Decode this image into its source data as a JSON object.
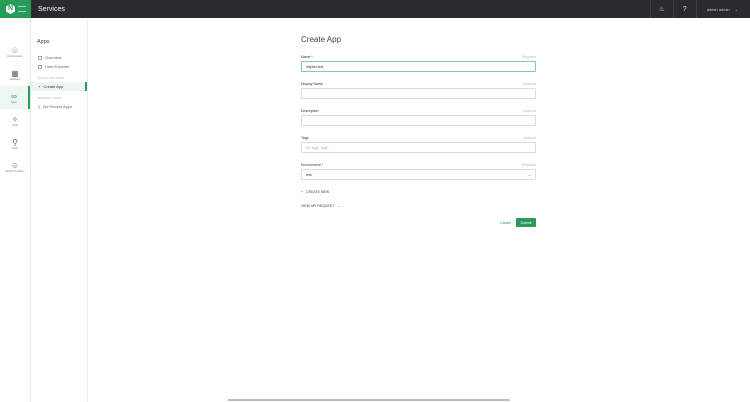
{
  "header": {
    "title": "Services",
    "user": "admin admin"
  },
  "rail": [
    {
      "label": "Environments",
      "icon": "bell-flask-icon"
    },
    {
      "label": "Gateways",
      "icon": "gateway-icon"
    },
    {
      "label": "Apps",
      "icon": "apps-icon",
      "active": true
    },
    {
      "label": "APIs",
      "icon": "api-icon"
    },
    {
      "label": "Certs",
      "icon": "certificate-icon"
    },
    {
      "label": "Identity Providers",
      "icon": "identity-icon"
    }
  ],
  "sidebar": {
    "title": "Apps",
    "items": [
      {
        "label": "Overview"
      },
      {
        "label": "Data Explorer"
      }
    ],
    "quick_actions_title": "QUICK ACTIONS",
    "create": "Create App",
    "recent_title": "RECENT APPS",
    "recent": "No Recent Apps"
  },
  "form": {
    "title": "Create App",
    "name": {
      "label": "Name *",
      "hint": "Required",
      "value": "httpbin-test"
    },
    "display_name": {
      "label": "Display Name",
      "hint": "Optional",
      "value": ""
    },
    "description": {
      "label": "Description",
      "hint": "Optional",
      "value": ""
    },
    "tags": {
      "label": "Tags",
      "hint": "Optional",
      "placeholder": "Ex: tag1, tag2, ..."
    },
    "environment": {
      "label": "Environment *",
      "hint": "Required",
      "value": "test"
    },
    "create_new": "CREATE NEW",
    "view_api": "VIEW API REQUEST",
    "cancel": "Cancel",
    "submit": "Submit"
  },
  "colors": {
    "accent": "#269b5a",
    "topbar": "#2a2b30"
  }
}
